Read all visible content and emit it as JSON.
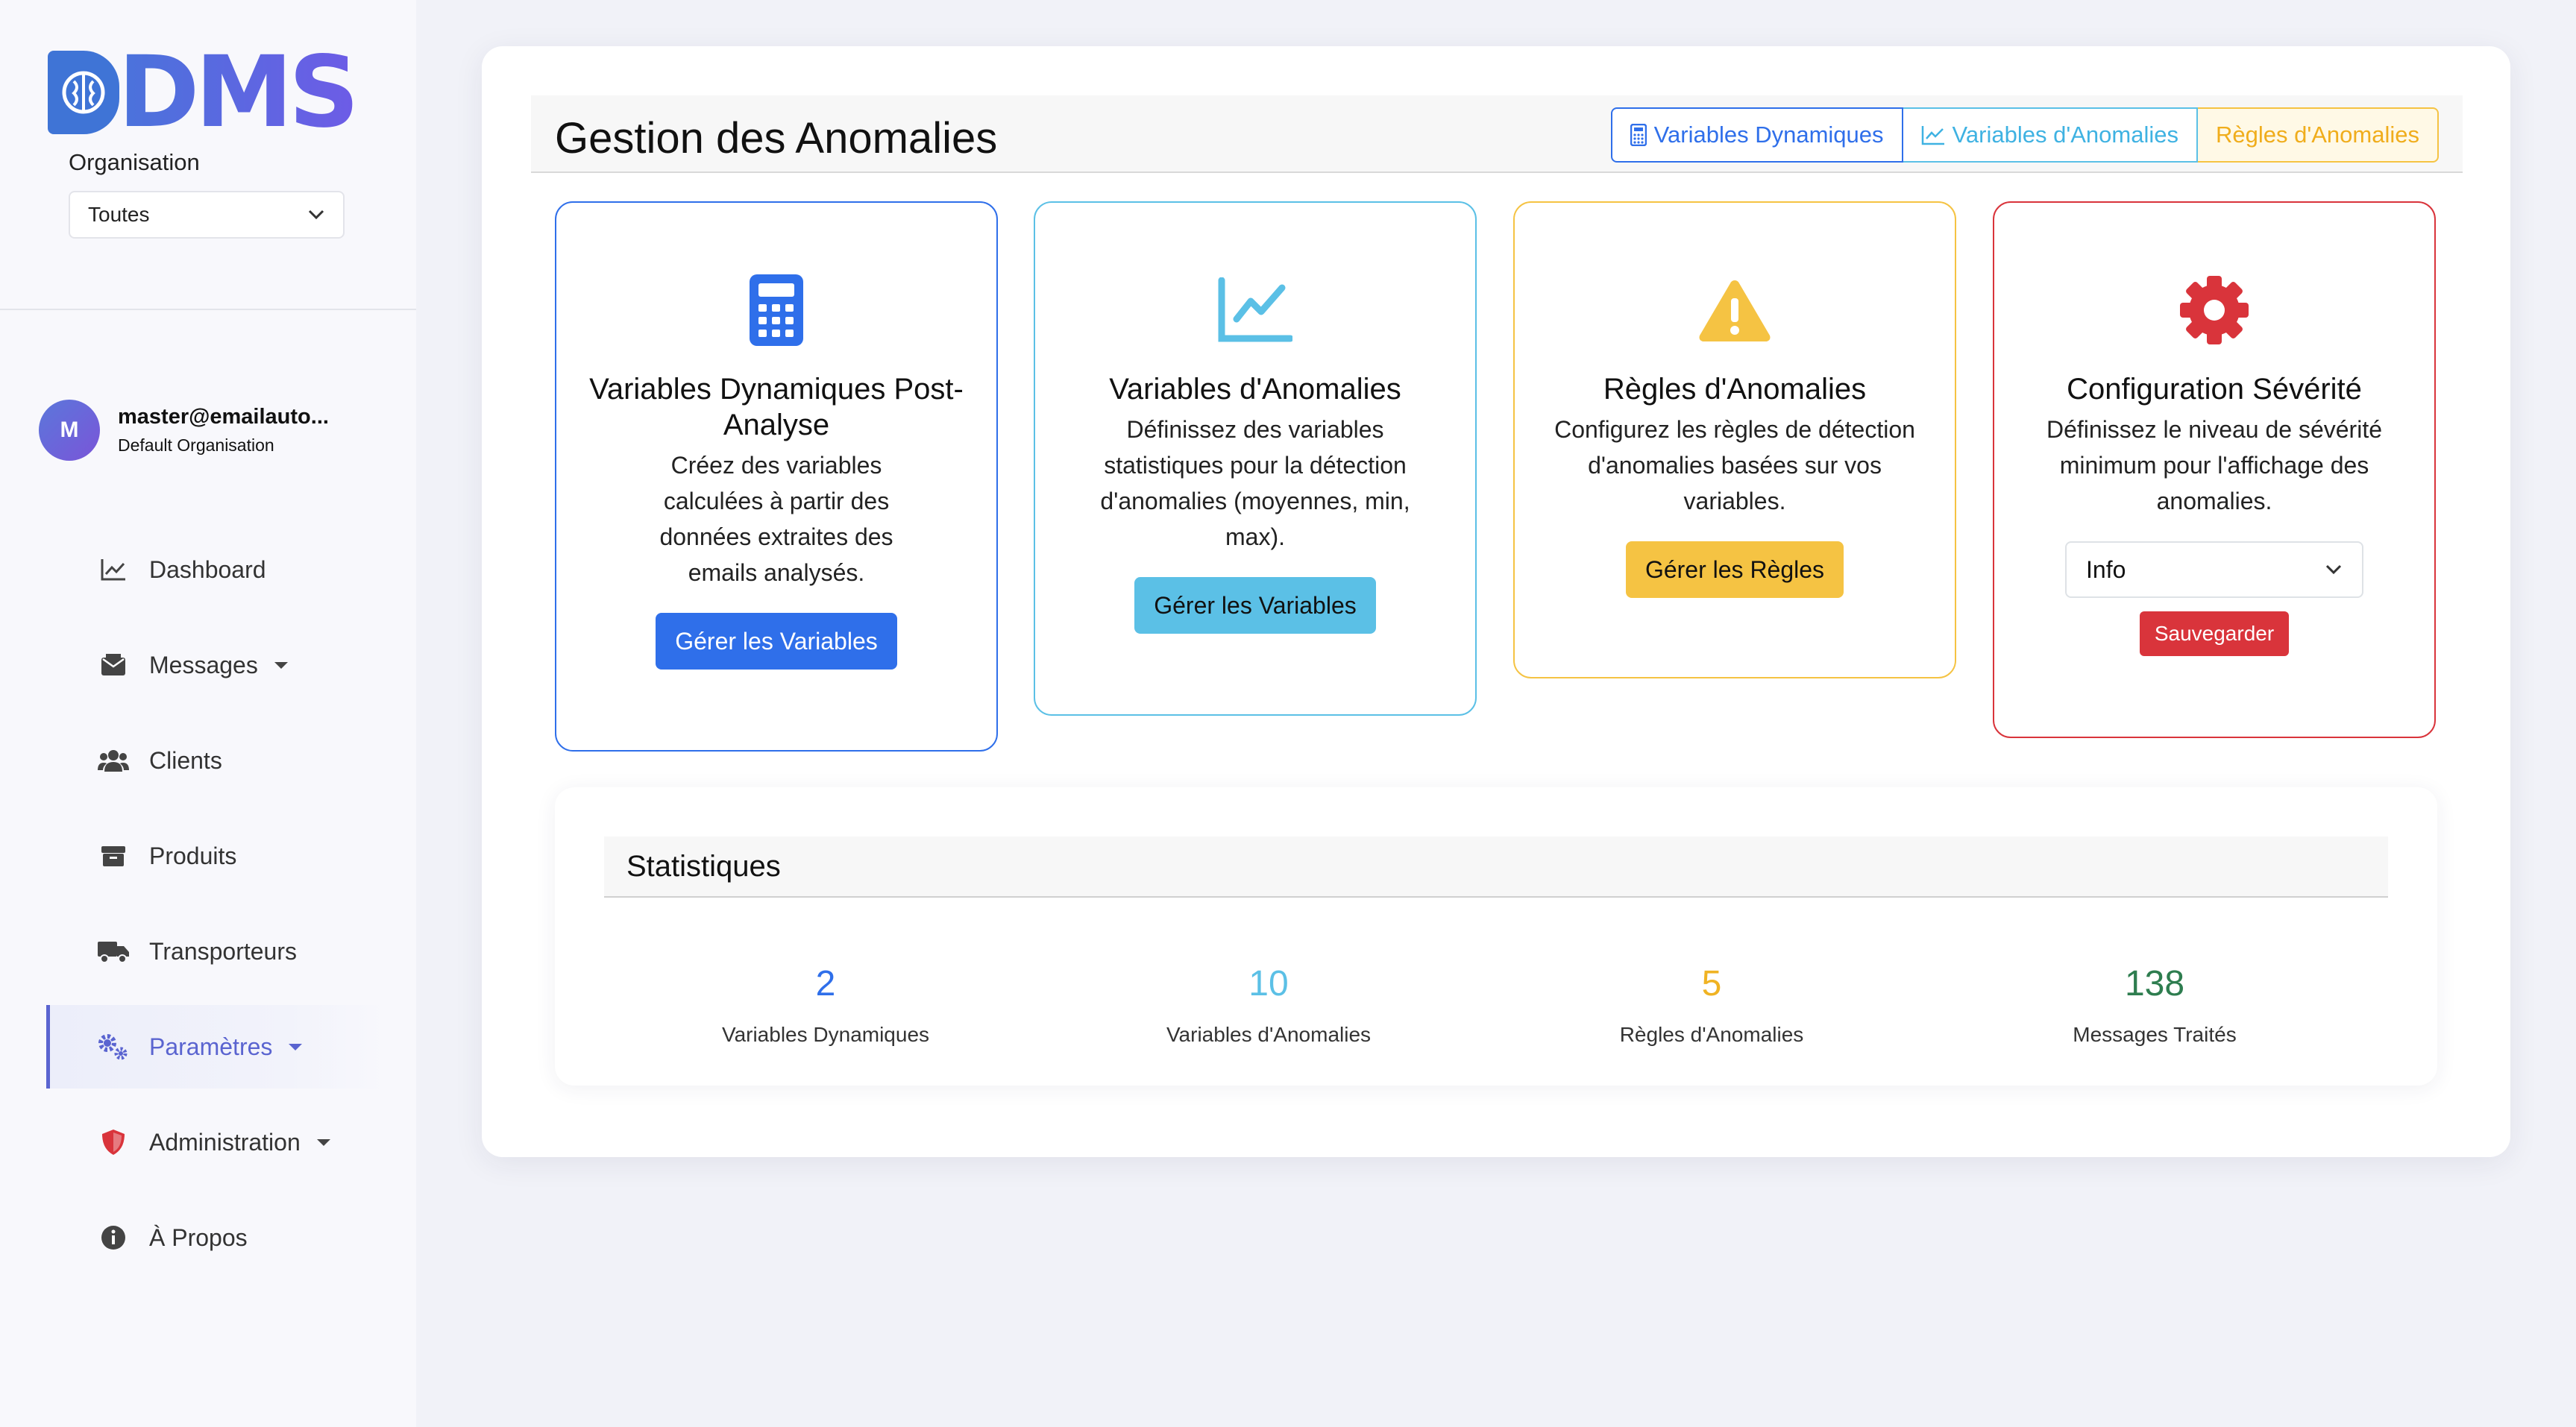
{
  "brand": {
    "logo_text": "DMS"
  },
  "sidebar": {
    "org_label": "Organisation",
    "org_value": "Toutes",
    "user": {
      "initial": "M",
      "email": "master@emailauto...",
      "org": "Default Organisation"
    },
    "items": [
      {
        "label": "Dashboard",
        "icon": "chart-line-icon"
      },
      {
        "label": "Messages",
        "icon": "envelope-icon",
        "has_caret": true
      },
      {
        "label": "Clients",
        "icon": "users-icon"
      },
      {
        "label": "Produits",
        "icon": "box-icon"
      },
      {
        "label": "Transporteurs",
        "icon": "truck-icon"
      },
      {
        "label": "Paramètres",
        "icon": "cogs-icon",
        "has_caret": true,
        "active": true
      },
      {
        "label": "Administration",
        "icon": "shield-icon",
        "has_caret": true
      },
      {
        "label": "À Propos",
        "icon": "info-circle-icon"
      }
    ]
  },
  "header": {
    "title": "Gestion des Anomalies",
    "tabs": [
      {
        "label": "Variables Dynamiques",
        "icon": "calculator-icon"
      },
      {
        "label": "Variables d'Anomalies",
        "icon": "chart-line-icon"
      },
      {
        "label": "Règles d'Anomalies"
      }
    ]
  },
  "cards": [
    {
      "icon": "calculator-icon",
      "title": "Variables Dynamiques Post-Analyse",
      "description": "Créez des variables calculées à partir des données extraites des emails analysés.",
      "button": "Gérer les Variables"
    },
    {
      "icon": "chart-line-icon",
      "title": "Variables d'Anomalies",
      "description": "Définissez des variables statistiques pour la détection d'anomalies (moyennes, min, max).",
      "button": "Gérer les Variables"
    },
    {
      "icon": "warning-icon",
      "title": "Règles d'Anomalies",
      "description": "Configurez les règles de détection d'anomalies basées sur vos variables.",
      "button": "Gérer les Règles"
    },
    {
      "icon": "cog-icon",
      "title": "Configuration Sévérité",
      "description": "Définissez le niveau de sévérité minimum pour l'affichage des anomalies.",
      "select_value": "Info",
      "button": "Sauvegarder"
    }
  ],
  "stats": {
    "title": "Statistiques",
    "items": [
      {
        "value": "2",
        "label": "Variables Dynamiques",
        "color": "#2f6fea"
      },
      {
        "value": "10",
        "label": "Variables d'Anomalies",
        "color": "#5bc0e6"
      },
      {
        "value": "5",
        "label": "Règles d'Anomalies",
        "color": "#f0b323"
      },
      {
        "value": "138",
        "label": "Messages Traités",
        "color": "#2e7d4f"
      }
    ]
  },
  "colors": {
    "primary": "#2f6fea",
    "info": "#5bc0e6",
    "warning": "#f5c343",
    "danger": "#d9343b",
    "accent": "#5a64d0"
  }
}
